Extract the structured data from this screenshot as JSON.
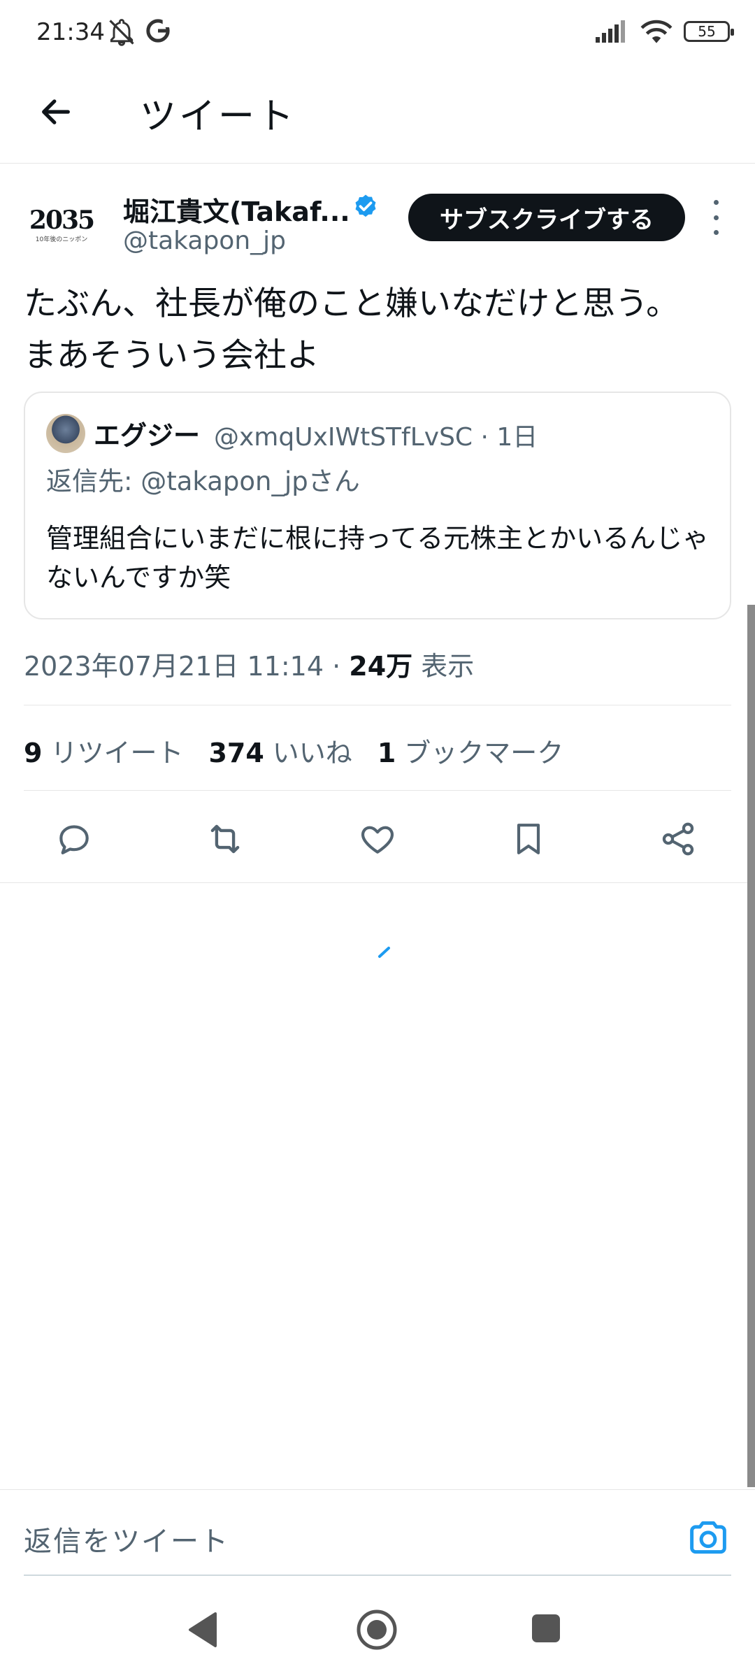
{
  "status_bar": {
    "time": "21:34",
    "battery": "55"
  },
  "header": {
    "title": "ツイート"
  },
  "tweet": {
    "author_name": "堀江貴文(Takaf...",
    "author_handle": "@takapon_jp",
    "avatar_text": "2035",
    "avatar_sub": "10年後のニッポン",
    "subscribe_label": "サブスクライブする",
    "text": "たぶん、社長が俺のこと嫌いなだけと思う。\nまあそういう会社よ",
    "timestamp": "2023年07月21日 11:14 · ",
    "views_count": "24万",
    "views_label": "表示"
  },
  "quoted_tweet": {
    "author_name": "エグジー",
    "author_handle": "@xmqUxIWtSTfLvSC · 1日",
    "reply_prefix": "返信先: ",
    "reply_to": "@takapon_jpさん",
    "text": "管理組合にいまだに根に持ってる元株主とかいるんじゃないんですか笑"
  },
  "stats": {
    "retweets_count": "9",
    "retweets_label": "リツイート",
    "likes_count": "374",
    "likes_label": "いいね",
    "bookmarks_count": "1",
    "bookmarks_label": "ブックマーク"
  },
  "reply_bar": {
    "placeholder": "返信をツイート"
  },
  "colors": {
    "accent": "#1d9bf0",
    "text_primary": "#0f1419",
    "text_secondary": "#536471"
  }
}
